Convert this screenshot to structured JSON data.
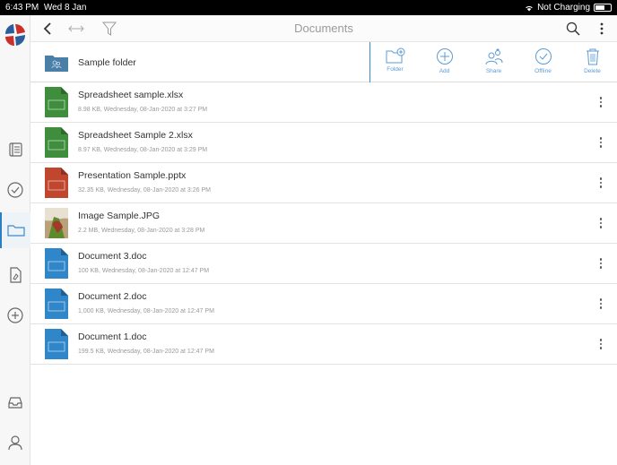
{
  "statusbar": {
    "time": "6:43 PM",
    "date": "Wed 8 Jan",
    "charging": "Not Charging"
  },
  "header": {
    "title": "Documents"
  },
  "folder": {
    "name": "Sample folder"
  },
  "actions": [
    {
      "label": "Folder",
      "icon": "new-folder-icon"
    },
    {
      "label": "Add",
      "icon": "add-icon"
    },
    {
      "label": "Share",
      "icon": "share-users-icon"
    },
    {
      "label": "Offline",
      "icon": "offline-check-icon"
    },
    {
      "label": "Delete",
      "icon": "trash-icon"
    }
  ],
  "files": [
    {
      "name": "Spreadsheet sample.xlsx",
      "meta": "8.98 KB, Wednesday, 08-Jan-2020 at 3:27 PM",
      "type": "xlsx",
      "badge": "XLSX",
      "color": "#3e8e3e"
    },
    {
      "name": "Spreadsheet Sample 2.xlsx",
      "meta": "8.97 KB, Wednesday, 08-Jan-2020 at 3:29 PM",
      "type": "xlsx",
      "badge": "XLSX",
      "color": "#3e8e3e"
    },
    {
      "name": "Presentation Sample.pptx",
      "meta": "32.35 KB, Wednesday, 08-Jan-2020 at 3:26 PM",
      "type": "pptx",
      "badge": "PPTX",
      "color": "#c0472e"
    },
    {
      "name": "Image Sample.JPG",
      "meta": "2.2 MB, Wednesday, 08-Jan-2020 at 3:28 PM",
      "type": "jpg",
      "badge": "",
      "color": "#6a8d3a"
    },
    {
      "name": "Document 3.doc",
      "meta": "100 KB, Wednesday, 08-Jan-2020 at 12:47 PM",
      "type": "doc",
      "badge": "DOC",
      "color": "#2f86c8"
    },
    {
      "name": "Document 2.doc",
      "meta": "1,000 KB, Wednesday, 08-Jan-2020 at 12:47 PM",
      "type": "doc",
      "badge": "DOC",
      "color": "#2f86c8"
    },
    {
      "name": "Document 1.doc",
      "meta": "199.5 KB, Wednesday, 08-Jan-2020 at 12:47 PM",
      "type": "doc",
      "badge": "DOC",
      "color": "#2f86c8"
    }
  ],
  "colors": {
    "accent": "#2a7fc1",
    "action": "#5b9bd5"
  }
}
